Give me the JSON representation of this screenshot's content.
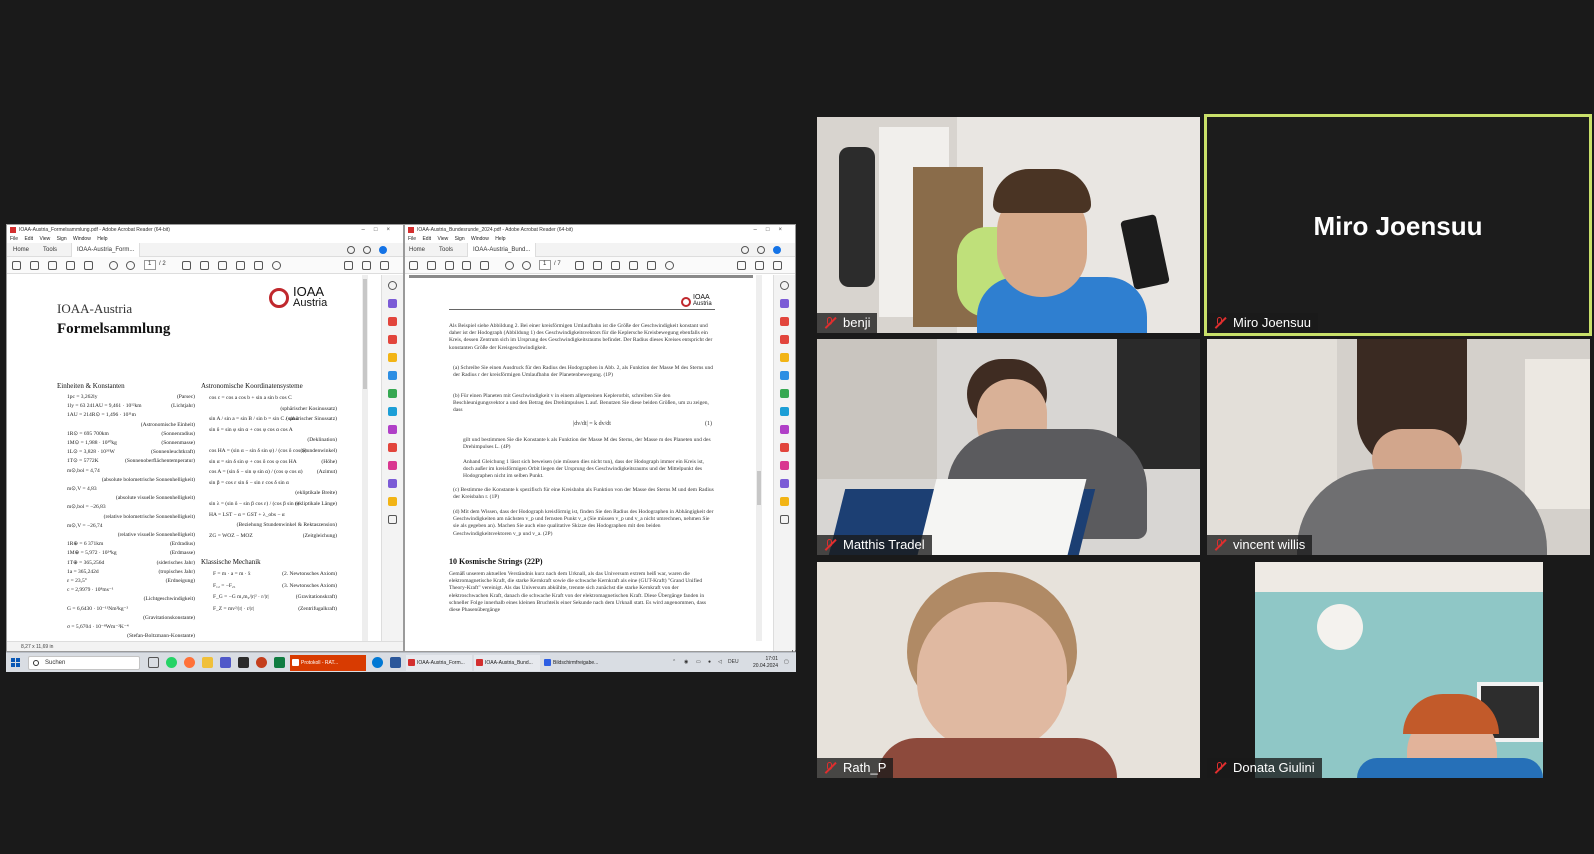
{
  "shared_screen": {
    "left_window": {
      "title": "IOAA-Austria_Formelsammlung.pdf - Adobe Acrobat Reader (64-bit)",
      "menu": [
        "File",
        "Edit",
        "View",
        "Sign",
        "Window",
        "Help"
      ],
      "tabs": {
        "home": "Home",
        "tools": "Tools",
        "doc": "IOAA-Austria_Form..."
      },
      "page": "1",
      "page_total": "/ 2",
      "status": "8,27 x 11,69 in",
      "document": {
        "org": "IOAA-Austria",
        "title": "Formelsammlung",
        "logo_line1": "IOAA",
        "logo_line2": "Austria",
        "section_constants": "Einheiten & Konstanten",
        "section_coords": "Astronomische Koordinatensysteme",
        "section_mechanics": "Klassische Mechanik",
        "constants": [
          {
            "value": "1pc = 3,262ly",
            "label": "(Parsec)"
          },
          {
            "value": "1ly = 63 241AU = 9,461 · 10¹²km",
            "label": "(Lichtjahr)"
          },
          {
            "value": "1AU = 214R⊙ = 1,496 · 10¹¹m",
            "label": ""
          },
          {
            "value": "",
            "label": "(Astronomische Einheit)"
          },
          {
            "value": "1R⊙ = 695 700km",
            "label": "(Sonnenradius)"
          },
          {
            "value": "1M⊙ = 1,988 · 10³⁰kg",
            "label": "(Sonnenmasse)"
          },
          {
            "value": "1L⊙ = 3,828 · 10²⁶W",
            "label": "(Sonnenleuchtkraft)"
          },
          {
            "value": "1T⊙ = 5772K",
            "label": "(Sonnenoberflächentemperatur)"
          },
          {
            "value": "m⊙,bol = 4,74",
            "label": ""
          },
          {
            "value": "",
            "label": "(absolute bolometrische Sonnenhelligkeit)"
          },
          {
            "value": "m⊙,V = 4,83",
            "label": ""
          },
          {
            "value": "",
            "label": "(absolute visuelle Sonnenhelligkeit)"
          },
          {
            "value": "m⊙,bol = −26,83",
            "label": ""
          },
          {
            "value": "",
            "label": "(relative bolometrische Sonnenhelligkeit)"
          },
          {
            "value": "m⊙,V = −26,74",
            "label": ""
          },
          {
            "value": "",
            "label": "(relative visuelle Sonnenhelligkeit)"
          },
          {
            "value": "1R⊕ = 6 371km",
            "label": "(Erdradius)"
          },
          {
            "value": "1M⊕ = 5,972 · 10²⁴kg",
            "label": "(Erdmasse)"
          },
          {
            "value": "1T⊕ = 365,256d",
            "label": "(siderisches Jahr)"
          },
          {
            "value": "1a = 365,242d",
            "label": "(tropisches Jahr)"
          },
          {
            "value": "ε = 23,5°",
            "label": "(Erdneigung)"
          },
          {
            "value": "c = 2,9979 · 10⁸ms⁻¹",
            "label": ""
          },
          {
            "value": "",
            "label": "(Lichtgeschwindigkeit)"
          },
          {
            "value": "G = 6,6430 · 10⁻¹¹Nm²kg⁻²",
            "label": ""
          },
          {
            "value": "",
            "label": "(Gravitationskonstante)"
          },
          {
            "value": "σ = 5,6704 · 10⁻⁸Wm⁻²K⁻⁴",
            "label": ""
          },
          {
            "value": "",
            "label": "(Stefan-Boltzmann-Konstante)"
          }
        ],
        "coords": [
          {
            "value": "cos c = cos a cos b + sin a sin b cos C",
            "label": ""
          },
          {
            "value": "",
            "label": "(sphärischer Kosinussatz)"
          },
          {
            "value": "sin A / sin a = sin B / sin b = sin C / sin c",
            "label": "(sphärischer Sinussatz)"
          },
          {
            "value": "sin δ = sin φ sin α + cos φ cos α cos A",
            "label": ""
          },
          {
            "value": "",
            "label": "(Deklination)"
          },
          {
            "value": "cos HA = (sin α − sin δ sin φ) / (cos δ cos φ)",
            "label": "(Stundenwinkel)"
          },
          {
            "value": "sin α = sin δ sin φ + cos δ cos φ cos HA",
            "label": "(Höhe)"
          },
          {
            "value": "cos A = (sin δ − sin φ sin α) / (cos φ cos α)",
            "label": "(Azimut)"
          },
          {
            "value": "sin β = cos ε sin δ − sin ε cos δ sin α",
            "label": ""
          },
          {
            "value": "",
            "label": "(ekliptikale Breite)"
          },
          {
            "value": "sin λ = (sin δ − sin β cos ε) / (cos β sin ε)",
            "label": "(ekliptikale Länge)"
          },
          {
            "value": "HA = LST − α = GST + λ_obs − α",
            "label": ""
          },
          {
            "value": "",
            "label": "(Beziehung Stundenwinkel & Rektaszension)"
          },
          {
            "value": "ZG = WOZ − MOZ",
            "label": "(Zeitgleichung)"
          }
        ],
        "mechanics": [
          {
            "value": "F = m · a = m · ẍ",
            "label": "(2. Newtonsches Axiom)"
          },
          {
            "value": "F₁₂ = −F₂₁",
            "label": "(3. Newtonsches Axiom)"
          },
          {
            "value": "F_G = −G m₁m₂/|r|² · r/|r|",
            "label": "(Gravitationskraft)"
          },
          {
            "value": "F_Z = mv²/|r| · r/|r|",
            "label": "(Zentrifugalkraft)"
          }
        ]
      }
    },
    "right_window": {
      "title": "IOAA-Austria_Bundesrunde_2024.pdf - Adobe Acrobat Reader (64-bit)",
      "menu": [
        "File",
        "Edit",
        "View",
        "Sign",
        "Window",
        "Help"
      ],
      "tabs": {
        "home": "Home",
        "tools": "Tools",
        "doc": "IOAA-Austria_Bund..."
      },
      "page": "1",
      "page_total": "/ 7",
      "document": {
        "logo_line1": "IOAA",
        "logo_line2": "Austria",
        "intro": "Als Beispiel siehe Abbildung 2. Bei einer kreisförmigen Umlaufbahn ist die Größe der Geschwindigkeit konstant und daher ist der Hodograph (Abbildung 1) des Geschwindigkeitsvektors für die Keplersche Kreisbewegung ebenfalls ein Kreis, dessen Zentrum sich im Ursprung des Geschwindigkeitsraums befindet. Der Radius dieses Kreises entspricht der konstanten Größe der Kreisgeschwindigkeit.",
        "items": [
          "(a) Schreibe Sie einen Ausdruck für den Radius des Hodographen in Abb. 2, als Funktion der Masse M des Sterns und der Radius r der kreisförmigen Umlaufbahn der Planetenbewegung. (1P)",
          "(b) Für einen Planeten mit Geschwindigkeit v in einem allgemeinen Keplerorbit, schreiben Sie den Beschleunigungsvektor a und den Betrag des Drehimpulses L auf. Benutzen Sie diese beiden Größen, um zu zeigen, dass",
          "gilt und bestimmen Sie die Konstante k als Funktion der Masse M des Sterns, der Masse m des Planeten und des Drehimpulses L. (4P)",
          "Anhand Gleichung 1 lässt sich beweisen (sie müssen dies nicht tun), dass der Hodograph immer ein Kreis ist, doch außer im kreisförmigen Orbit liegen der Ursprung des Geschwindigkeitsraums und der Mittelpunkt des Hodographen nicht im selben Punkt.",
          "(c) Bestimme die Konstante k spezifisch für eine Kreisbahn als Funktion von der Masse des Sterns M und dem Radius der Kreisbahn r. (1P)",
          "(d) Mit dem Wissen, dass der Hodograph kreisförmig ist, finden Sie den Radius des Hodographen in Abhängigkeit der Geschwindigkeiten am nächsten v_p und fernsten Punkt v_a (Sie müssen v_p und v_a nicht umrechnen, nehmen Sie sie als gegeben an). Machen Sie auch eine qualitative Skizze des Hodographen mit den beiden Geschwindigkeitsvektoren v_p und v_a. (2P)"
        ],
        "equation": "|dv/dt| = k dv/dt",
        "equation_no": "(1)",
        "section_heading": "10   Kosmische Strings (22P)",
        "section_text": "Gemäß unserem aktuellen Verständnis kurz nach dem Urknall, als das Universum extrem heiß war, waren die elektromagnetische Kraft, die starke Kernkraft sowie die schwache Kernkraft als eine (GUT-Kraft) \"Grand Unified Theory-Kraft\" vereinigt. Als das Universum abkühlte, trennte sich zunächst die starke Kernkraft von der elektroschwachen Kraft, danach die schwache Kraft von der elektromagnetischen Kraft. Diese Übergänge fanden in schneller Folge innerhalb eines kleinen Bruchteils einer Sekunde nach dem Urknall statt. Es wird angenommen, dass diese Phasenübergänge"
      }
    },
    "taskbar": {
      "search": "Suchen",
      "tasks": [
        "Protokoll - RAT...",
        "IOAA-Austria_Form...",
        "IOAA-Austria_Bund...",
        "Bildschirmfreigabe..."
      ],
      "lang": "DEU",
      "time": "17:01",
      "date": "20.04.2024"
    }
  },
  "participants": [
    {
      "name": "benji",
      "muted": true
    },
    {
      "name": "Miro Joensuu",
      "muted": true,
      "camera_off": true,
      "active_speaker": true
    },
    {
      "name": "Matthis Tradel",
      "muted": true
    },
    {
      "name": "vincent willis",
      "muted": true
    },
    {
      "name": "Rath_P",
      "muted": true
    },
    {
      "name": "Donata Giulini",
      "muted": true
    }
  ],
  "colors": {
    "background": "#1a1a1a",
    "active_speaker_border": "#c9e06a",
    "muted_icon": "#e02e2e",
    "pdf_accent": "#c0282d",
    "acrobat_blue": "#1473e6"
  }
}
